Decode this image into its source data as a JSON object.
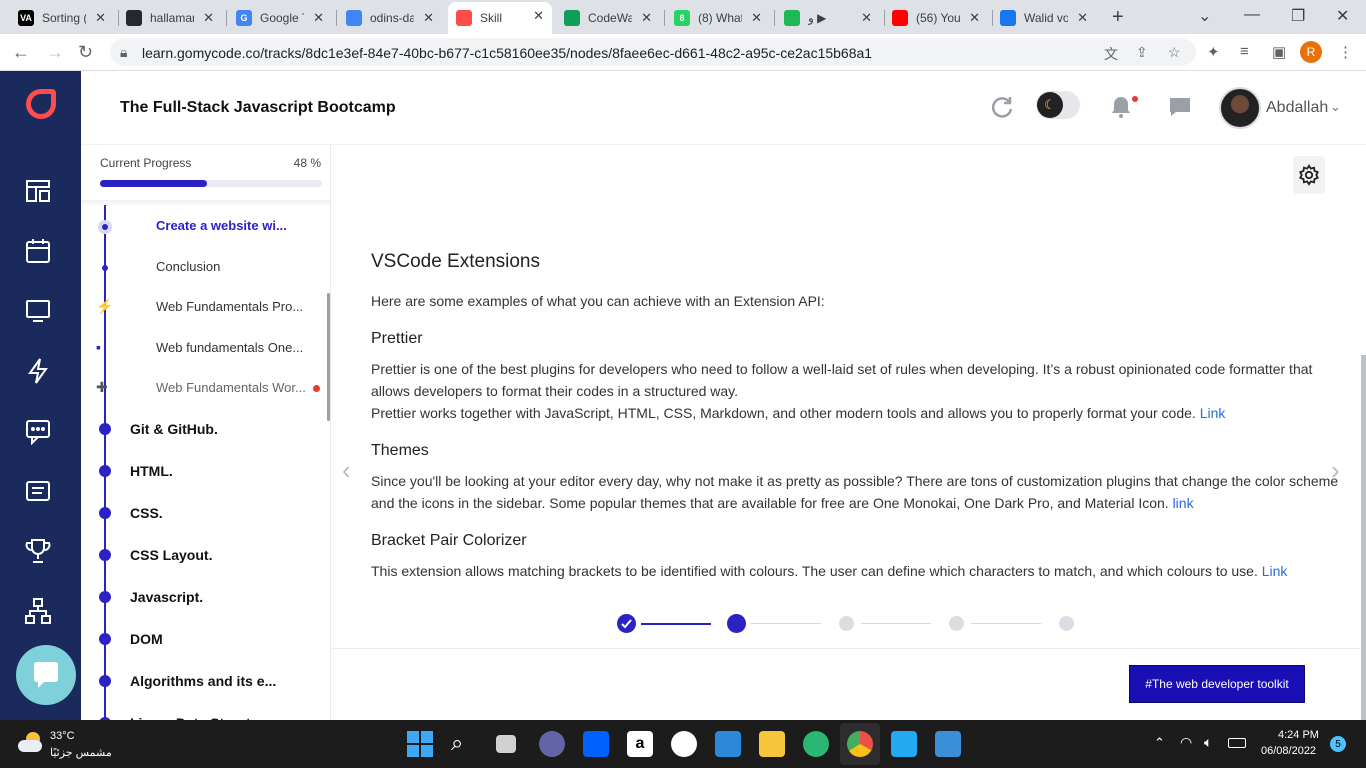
{
  "browser": {
    "tabs": [
      {
        "title": "Sorting (",
        "fav": "VA",
        "color": "#000000"
      },
      {
        "title": "hallamar",
        "fav": "",
        "color": "#24292f"
      },
      {
        "title": "Google T",
        "fav": "G",
        "color": "#4285f4"
      },
      {
        "title": "odins-da",
        "fav": "",
        "color": "#4285f4"
      },
      {
        "title": "Skill",
        "fav": "",
        "color": "#ff4c4c"
      },
      {
        "title": "CodeWa",
        "fav": "",
        "color": "#0f9d58"
      },
      {
        "title": "(8) What",
        "fav": "8",
        "color": "#25d366"
      },
      {
        "title": "و ▶",
        "fav": "",
        "color": "#1db954"
      },
      {
        "title": "(56) You",
        "fav": "",
        "color": "#ff0000"
      },
      {
        "title": "Walid vo",
        "fav": "",
        "color": "#1877f2"
      }
    ],
    "url": "learn.gomycode.co/tracks/8dc1e3ef-84e7-40bc-b677-c1c58160ee35/nodes/8faee6ec-d661-48c2-a95c-ce2ac15b68a1",
    "profile_initial": "R"
  },
  "header": {
    "course_title": "The Full-Stack Javascript Bootcamp",
    "username": "Abdallah"
  },
  "sidebar": {
    "progress_label": "Current Progress",
    "progress_value": "48 %",
    "progress_fraction": 0.48,
    "sub_items": [
      {
        "label": "Create a website wi...",
        "state": "active"
      },
      {
        "label": "Conclusion",
        "state": "normal"
      },
      {
        "label": "Web Fundamentals Pro...",
        "state": "normal"
      },
      {
        "label": "Web fundamentals One...",
        "state": "normal"
      },
      {
        "label": "Web Fundamentals Wor...",
        "state": "muted"
      }
    ],
    "modules": [
      "Git & GitHub.",
      "HTML.",
      "CSS.",
      "CSS Layout.",
      "Javascript.",
      "DOM",
      "Algorithms and its e...",
      "Linear Data Structur..."
    ]
  },
  "lesson": {
    "title": "VSCode Extensions",
    "intro": "Here are some examples of what you can achieve with an Extension API:",
    "sections": [
      {
        "heading": "Prettier",
        "paragraphs": [
          {
            "text": "Prettier is one of the best plugins for developers who need to follow a well-laid set of rules when developing. It’s a robust opinionated code formatter that allows developers to format their codes in a structured way.",
            "link": ""
          },
          {
            "text": "Prettier works together with JavaScript, HTML, CSS, Markdown, and other modern tools and allows you to properly format your code. ",
            "link": "Link"
          }
        ]
      },
      {
        "heading": "Themes",
        "paragraphs": [
          {
            "text": "Since you'll be looking at your editor every day, why not make it as pretty as possible? There are tons of customization plugins that change the color scheme and the icons in the sidebar. Some popular themes that are available for free are One Monokai, One Dark Pro, and Material Icon. ",
            "link": "link"
          }
        ]
      },
      {
        "heading": "Bracket Pair Colorizer",
        "paragraphs": [
          {
            "text": "This extension allows matching brackets to be identified with colours. The user can define which characters to match, and which colours to use. ",
            "link": "Link"
          }
        ]
      }
    ],
    "steps_total": 5,
    "steps_current": 2,
    "tag_button": "#The web developer toolkit"
  },
  "taskbar": {
    "temperature": "33°C",
    "weather": "مشمس جزئيًا",
    "time": "4:24 PM",
    "date": "06/08/2022",
    "notifications": "5"
  },
  "colors": {
    "brand": "#2b22c6",
    "rail": "#1b2a5c",
    "logo": "#ff4c4c"
  }
}
